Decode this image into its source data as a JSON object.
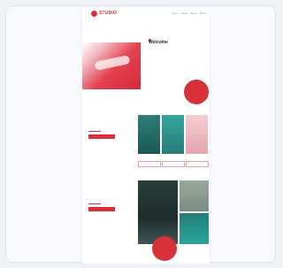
{
  "app": {
    "title": ""
  },
  "header": {
    "logo_text": "STUDIO",
    "nav": [
      "Home",
      "About",
      "Shop",
      "Menu"
    ]
  },
  "hero": {
    "title": "Welcome",
    "subtitle": "",
    "body": "",
    "badge_label": ""
  },
  "section_books": {
    "title": "",
    "body": "",
    "button_label": "",
    "book_labels": [
      "",
      "",
      ""
    ]
  },
  "section_photos": {
    "title": "",
    "body": "",
    "button_label": "",
    "photo_label": ""
  },
  "colors": {
    "accent": "#d8313a",
    "teal": "#2a7c78"
  }
}
